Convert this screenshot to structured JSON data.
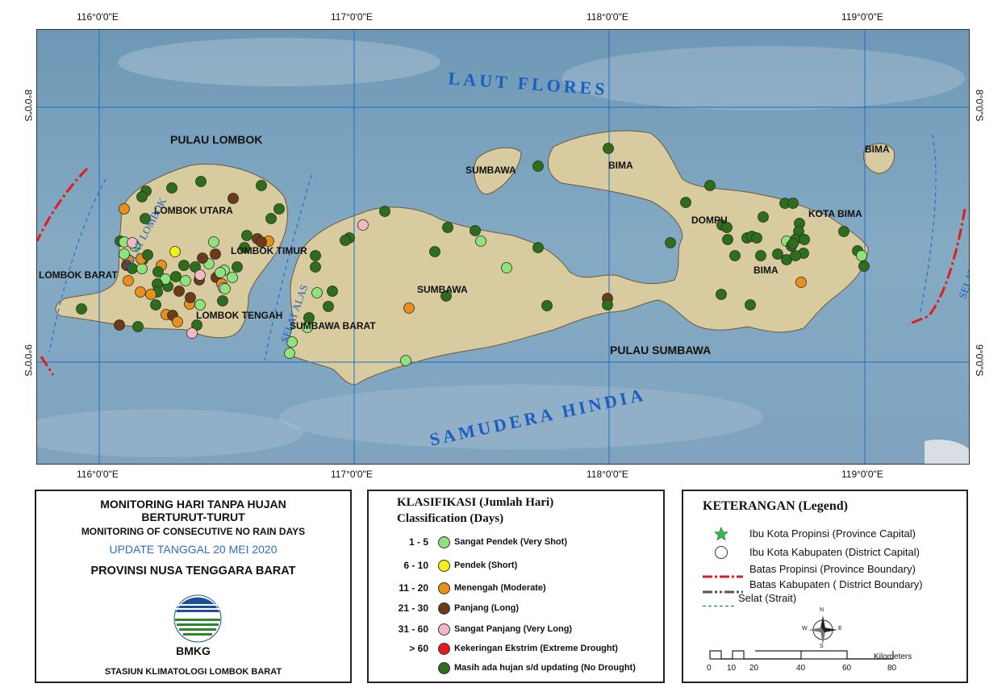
{
  "map": {
    "lon_labels": [
      "116°0'0\"E",
      "117°0'0\"E",
      "118°0'0\"E",
      "119°0'0\"E"
    ],
    "lat_labels": [
      "8°0'0\"S",
      "9°0'0\"S"
    ],
    "sea_labels": {
      "north": "LAUT FLORES",
      "south": "SAMUDERA HINDIA"
    },
    "island_labels": {
      "lombok": "PULAU LOMBOK",
      "sumbawa": "PULAU SUMBAWA",
      "bima_island": "BIMA"
    },
    "region_labels": {
      "lombok_utara": "LOMBOK UTARA",
      "lombok_barat": "LOMBOK BARAT",
      "lombok_tengah": "LOMBOK TENGAH",
      "lombok_timur": "LOMBOK TIMUR",
      "sumbawa_barat": "SUMBAWA BARAT",
      "sumbawa": "SUMBAWA",
      "sumbawa_north": "SUMBAWA",
      "dompu": "DOMPU",
      "bima": "BIMA",
      "bima_north": "BIMA",
      "kota_bima": "KOTA BIMA"
    },
    "strait_labels": {
      "selat_lombok": "SELAT LOMBOK",
      "selat_alas": "SELAT ALAS",
      "selat_sape": "SELAT SAPE"
    },
    "colors": {
      "sea": "#7fa6c0",
      "land": "#d8cba0",
      "grid": "#1a6fc4",
      "very_short": "#8fe37a",
      "short": "#f4ee1a",
      "moderate": "#e8901a",
      "long": "#6b3c17",
      "very_long": "#f2b8c6",
      "extreme": "#e51b1b",
      "no_drought": "#2c6e1a"
    }
  },
  "title_panel": {
    "line1": "MONITORING HARI TANPA HUJAN",
    "line2": "BERTURUT-TURUT",
    "line3": "MONITORING OF CONSECUTIVE NO RAIN DAYS",
    "update": "UPDATE TANGGAL 20 MEI 2020",
    "province": "PROVINSI NUSA TENGGARA BARAT",
    "logo_text": "BMKG",
    "station": "STASIUN KLIMATOLOGI LOMBOK BARAT"
  },
  "classification": {
    "title_line1": "KLASIFIKASI (Jumlah Hari)",
    "title_line2": "Classification (Days)",
    "items": [
      {
        "range": "1 - 5",
        "label": "Sangat Pendek (Very Shot)",
        "color": "#8fe37a"
      },
      {
        "range": "6 - 10",
        "label": "Pendek (Short)",
        "color": "#f4ee1a"
      },
      {
        "range": "11 - 20",
        "label": "Menengah (Moderate)",
        "color": "#e8901a"
      },
      {
        "range": "21 - 30",
        "label": "Panjang (Long)",
        "color": "#6b3c17"
      },
      {
        "range": "31 - 60",
        "label": "Sangat Panjang (Very Long)",
        "color": "#f2b8c6"
      },
      {
        "range": "> 60",
        "label": "Kekeringan Ekstrim (Extreme Drought)",
        "color": "#e51b1b"
      },
      {
        "range": "",
        "label": "Masih ada hujan s/d updating (No Drought)",
        "color": "#2c6e1a"
      }
    ]
  },
  "legend": {
    "title": "KETERANGAN (Legend)",
    "items": [
      {
        "icon": "star-icon",
        "label": "Ibu Kota Propinsi (Province Capital)"
      },
      {
        "icon": "circle-icon",
        "label": "Ibu Kota Kabupaten (District Capital)"
      },
      {
        "icon": "dash-dot-red-line",
        "label": "Batas Propinsi (Province Boundary)"
      },
      {
        "icon": "dash-dot-gray-line",
        "label": "Batas Kabupaten ( District Boundary)"
      },
      {
        "icon": "dashed-blue-line",
        "label": "Selat (Strait)"
      }
    ],
    "compass_letters": {
      "n": "N",
      "s": "S",
      "e": "E",
      "w": "W"
    },
    "scale_unit": "Kilometers",
    "scale_ticks": [
      "0",
      "10",
      "20",
      "40",
      "60",
      "80"
    ]
  }
}
